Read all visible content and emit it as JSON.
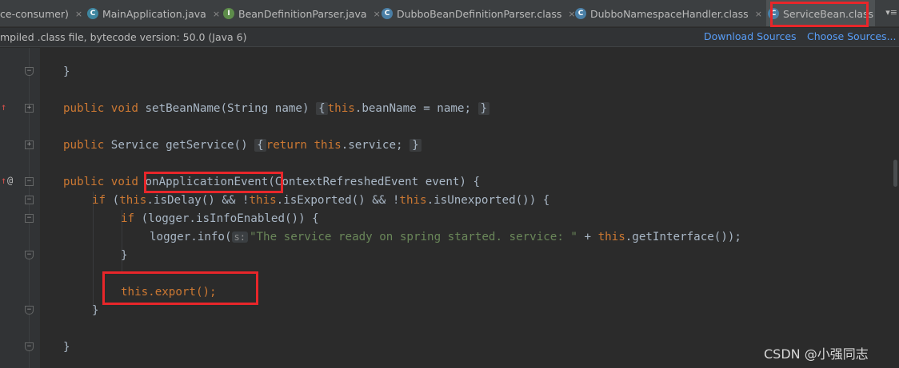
{
  "tabs": [
    {
      "label": "ce-consumer)",
      "icon": "none"
    },
    {
      "label": "MainApplication.java",
      "icon": "class-java-icon",
      "glyph": "C"
    },
    {
      "label": "BeanDefinitionParser.java",
      "icon": "interface-java-icon",
      "glyph": "I"
    },
    {
      "label": "DubboBeanDefinitionParser.class",
      "icon": "class-file-icon",
      "glyph": "C"
    },
    {
      "label": "DubboNamespaceHandler.class",
      "icon": "class-file-icon",
      "glyph": "C"
    },
    {
      "label": "ServiceBean.class",
      "icon": "class-file-icon",
      "glyph": "C",
      "active": true
    }
  ],
  "tab_close_glyph": "×",
  "tab_overflow": "▾≡",
  "infobar": {
    "message": "mpiled .class file, bytecode version: 50.0 (Java 6)",
    "download_sources": "Download Sources",
    "choose_sources": "Choose Sources..."
  },
  "gutter": {
    "override_mark": "↑",
    "annotation_mark": "@",
    "fold_open": "−",
    "fold_collapsed": "+"
  },
  "code": {
    "l1_brace": "}",
    "l2_kw": "public void",
    "l2_rest": " setBeanName(String name)",
    "l2_b1": "{",
    "l2_this": "this",
    "l2_body": ".beanName = name;",
    "l2_b2": "}",
    "l3_kw": "public",
    "l3_rest": " Service getService()",
    "l3_b1": "{",
    "l3_ret": "return",
    "l3_this": "this",
    "l3_body": ".service;",
    "l3_b2": "}",
    "l4_kw": "public void",
    "l4_name": "onApplicationEvent",
    "l4_rest": "(ContextRefreshedEvent event) {",
    "l5_if": "if",
    "l5_a": " (",
    "l5_this1": "this",
    "l5_b": ".isDelay() && !",
    "l5_this2": "this",
    "l5_c": ".isExported() && !",
    "l5_this3": "this",
    "l5_d": ".isUnexported()) {",
    "l6_if": "if",
    "l6_rest": " (logger.isInfoEnabled()) {",
    "l7_a": "logger.info(",
    "l7_hint": "s:",
    "l7_str": "\"The service ready on spring started. service: \"",
    "l7_b": " + ",
    "l7_this": "this",
    "l7_c": ".getInterface());",
    "l8_brace": "}",
    "l9_this": "this",
    "l9_rest": ".export();",
    "l10_brace": "}",
    "l11_brace": "}"
  },
  "watermark": "CSDN @小强同志",
  "colors": {
    "keyword": "#cc7832",
    "string": "#6a8759",
    "text": "#a9b7c6",
    "link": "#589df6",
    "annotation_box": "#e8262a"
  }
}
